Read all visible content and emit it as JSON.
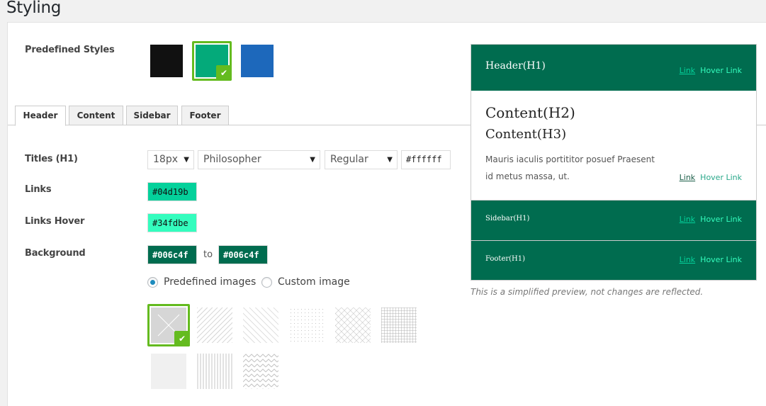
{
  "page": {
    "title": "Styling"
  },
  "predefined_styles": {
    "label": "Predefined Styles",
    "swatches": [
      {
        "name": "black",
        "color": "#111111",
        "selected": false
      },
      {
        "name": "green",
        "color": "#04aa7a",
        "selected": true
      },
      {
        "name": "blue",
        "color": "#1d68bb",
        "selected": false
      }
    ],
    "check_glyph": "✔"
  },
  "tabs": [
    {
      "label": "Header",
      "active": true
    },
    {
      "label": "Content",
      "active": false
    },
    {
      "label": "Sidebar",
      "active": false
    },
    {
      "label": "Footer",
      "active": false
    }
  ],
  "form": {
    "titles": {
      "label": "Titles (H1)",
      "size": "18px",
      "font": "Philosopher",
      "weight": "Regular",
      "color": "#ffffff",
      "arrow": "▼"
    },
    "links": {
      "label": "Links",
      "color": "#04d19b"
    },
    "links_hover": {
      "label": "Links Hover",
      "color": "#34fdbe"
    },
    "background": {
      "label": "Background",
      "from": "#006c4f",
      "to_label": "to",
      "to": "#006c4f",
      "options": [
        {
          "label": "Predefined images",
          "checked": true
        },
        {
          "label": "Custom image",
          "checked": false
        }
      ]
    },
    "patterns": [
      {
        "name": "none",
        "selected": true
      },
      {
        "name": "diagonal-right",
        "selected": false
      },
      {
        "name": "diagonal-left",
        "selected": false
      },
      {
        "name": "dots",
        "selected": false
      },
      {
        "name": "crosshatch",
        "selected": false
      },
      {
        "name": "grid",
        "selected": false
      },
      {
        "name": "noise",
        "selected": false
      },
      {
        "name": "vertical-lines",
        "selected": false
      },
      {
        "name": "zigzag",
        "selected": false
      }
    ]
  },
  "preview": {
    "colors": {
      "bg": "#006c4f",
      "link": "#04d19b",
      "hover": "#34fdbe",
      "content_link": "#1b5e48",
      "content_hover": "#2aa88a"
    },
    "header": {
      "title": "Header(H1)",
      "link": "Link",
      "hover": "Hover Link"
    },
    "content": {
      "h2": "Content(H2)",
      "h3": "Content(H3)",
      "paragraph_line1": "Mauris iaculis portititor posuef Praesent",
      "paragraph_line2": "id metus massa, ut.",
      "link": "Link",
      "hover": "Hover Link"
    },
    "sidebar": {
      "title": "Sidebar(H1)",
      "link": "Link",
      "hover": "Hover Link"
    },
    "footer": {
      "title": "Footer(H1)",
      "link": "Link",
      "hover": "Hover Link"
    },
    "note": "This is a simplified preview, not changes are reflected."
  }
}
